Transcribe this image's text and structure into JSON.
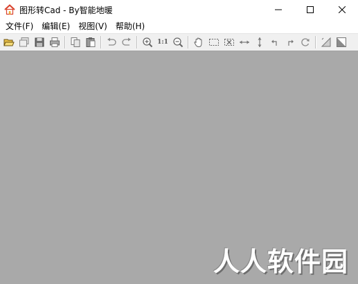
{
  "window": {
    "title": "图形转Cad - By智能地暖",
    "icon": "house-icon"
  },
  "controls": {
    "minimize": "minimize-icon",
    "maximize": "maximize-icon",
    "close": "close-icon"
  },
  "menu": [
    {
      "label": "文件(F)"
    },
    {
      "label": "编辑(E)"
    },
    {
      "label": "视图(V)"
    },
    {
      "label": "帮助(H)"
    }
  ],
  "toolbar": {
    "icons": [
      "open-folder-icon",
      "copy-window-icon",
      "save-icon",
      "print-icon",
      "copy-icon",
      "paste-icon",
      "undo-icon",
      "redo-icon",
      "zoom-in-icon",
      "actual-size-icon",
      "zoom-out-icon",
      "pan-hand-icon",
      "select-rect-icon",
      "crop-icon",
      "flip-horizontal-icon",
      "flip-vertical-icon",
      "rotate-left-icon",
      "rotate-right-icon",
      "rotate-icon",
      "triangle-icon",
      "triangle-fill-icon"
    ],
    "actual_size_label": "1:1"
  },
  "watermark": "人人软件园",
  "colors": {
    "canvas": "#a9a9a9",
    "toolbar": "#f0f0f0",
    "icon_roof": "#d9412b"
  }
}
